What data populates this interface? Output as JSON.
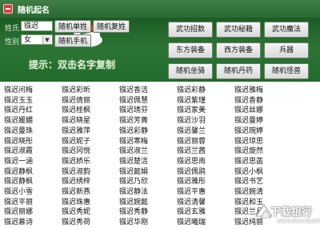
{
  "window": {
    "title": "随机起名"
  },
  "form": {
    "surname_label": "姓氏",
    "surname_value": "镪迟",
    "gender_label": "性别",
    "gender_value": "女"
  },
  "left_buttons": [
    "随机单姓",
    "随机复姓",
    "随机手机"
  ],
  "right_buttons": [
    "武功招数",
    "武功秘籍",
    "武功魔法",
    "东方装备",
    "西方装备",
    "兵器",
    "随机坐骑",
    "随机丹药",
    "随机怪兽"
  ],
  "hint": "提示：双击名字复制",
  "names": [
    [
      "镪迟问梅",
      "镪迟彩昕",
      "镪迟香洁",
      "镪迟彩静",
      "镪迟雅梅"
    ],
    [
      "镪迟玉玉",
      "镪迟倩丽",
      "镪迟佩慧",
      "镪迟紫瑾",
      "镪迟香静"
    ],
    [
      "镪迟丹红",
      "镪迟桂枫",
      "镪迟琇芬",
      "镪迟家美",
      "镪迟丝娜"
    ],
    [
      "镪迟媛媚",
      "镪迟晓星",
      "镪迟芳菁",
      "镪迟沙羽",
      "镪迟曼婷"
    ],
    [
      "镪迟曼珠",
      "镪迟雅萍",
      "镪迟彩静",
      "镪迟馨兰",
      "镪迟琬婷"
    ],
    [
      "镪迟晓彤",
      "镪迟妮子",
      "镪迟寒梅",
      "镪迟丽蓉",
      "镪迟琼思"
    ],
    [
      "镪迟淑霞",
      "镪迟冈悦",
      "镪迟淑兰",
      "镪迟兰茜",
      "镪迟旋然"
    ],
    [
      "镪迟一涵",
      "镪迟娇乐",
      "镪迟楚洁",
      "镪迟思雨",
      "镪迟思菡"
    ],
    [
      "镪迟静枫",
      "镪迟淑韵",
      "镪迟懿娟",
      "镪迟佩鹃",
      "镪迟小枫"
    ],
    [
      "镪迟静枫",
      "镪迟绣梓",
      "镪迟乃欣",
      "镪迟雅彤",
      "镪迟书艺"
    ],
    [
      "镪迟小雪",
      "镪迟新燕",
      "镪迟静法",
      "镪迟平惠",
      "镪迟婉清"
    ],
    [
      "镪迟平丽",
      "镪迟珠惠",
      "镪迟婉懿",
      "镪迟清馨",
      "镪迟和玉"
    ],
    [
      "镪迟丽娜",
      "镪迟秀妮",
      "镪迟秀静",
      "镪迟玄雅",
      "镪迟兰月"
    ],
    [
      "镪迟慕诗",
      "镪迟秀荷",
      "镪迟华刚",
      "镪迟曦瑞",
      "镪迟纯丽"
    ]
  ],
  "watermark": {
    "text": "下载银行",
    "sub": "www.downbank.cn"
  }
}
